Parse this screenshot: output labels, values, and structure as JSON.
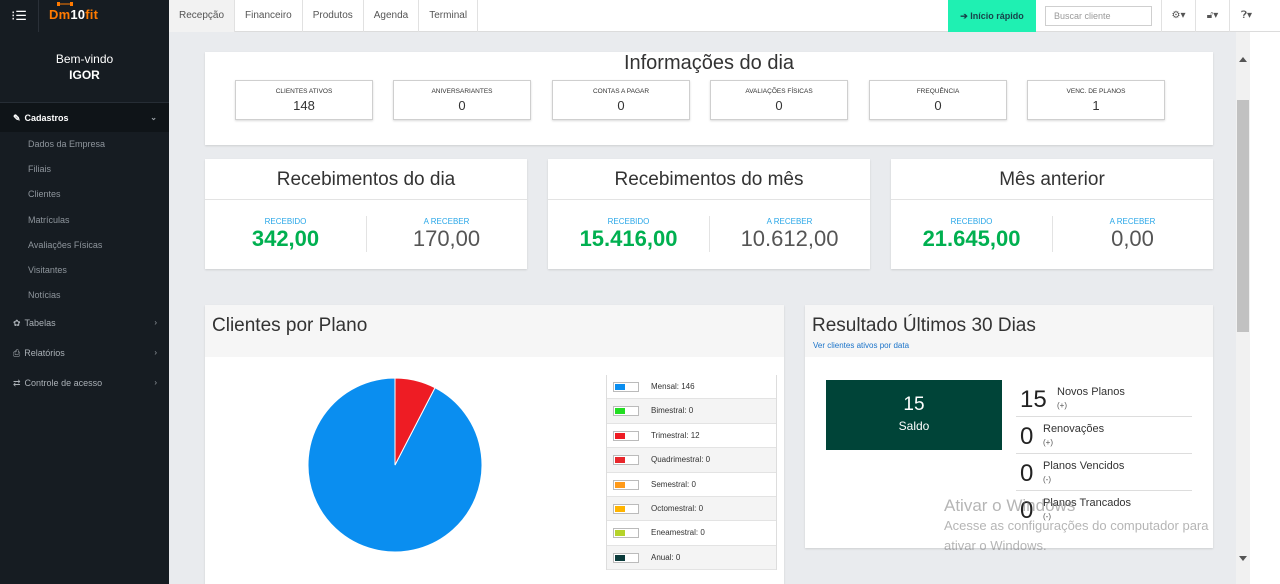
{
  "topbar": {
    "logo": {
      "prefix": "Dm",
      "mid": "10",
      "suffix": "fit"
    },
    "tabs": [
      "Recepção",
      "Financeiro",
      "Produtos",
      "Agenda",
      "Terminal"
    ],
    "quick_start": "Início rápido",
    "search_placeholder": "Buscar cliente"
  },
  "sidebar": {
    "welcome": "Bem-vindo",
    "user": "IGOR",
    "section": "Cadastros",
    "subitems": [
      "Dados da Empresa",
      "Filiais",
      "Clientes",
      "Matrículas",
      "Avaliações Físicas",
      "Visitantes",
      "Notícias"
    ],
    "menus": [
      "Tabelas",
      "Relatórios",
      "Controle de acesso"
    ]
  },
  "info_dia": {
    "title": "Informações do dia",
    "stats": [
      {
        "label": "CLIENTES ATIVOS",
        "value": "148"
      },
      {
        "label": "ANIVERSARIANTES",
        "value": "0"
      },
      {
        "label": "CONTAS A PAGAR",
        "value": "0"
      },
      {
        "label": "AVALIAÇÕES FÍSICAS",
        "value": "0"
      },
      {
        "label": "FREQUÊNCIA",
        "value": "0"
      },
      {
        "label": "VENC. DE PLANOS",
        "value": "1"
      }
    ]
  },
  "recebimentos": [
    {
      "title": "Recebimentos do dia",
      "recebido_label": "RECEBIDO",
      "recebido": "342,00",
      "areceber_label": "A RECEBER",
      "areceber": "170,00"
    },
    {
      "title": "Recebimentos do mês",
      "recebido_label": "RECEBIDO",
      "recebido": "15.416,00",
      "areceber_label": "A RECEBER",
      "areceber": "10.612,00"
    },
    {
      "title": "Mês anterior",
      "recebido_label": "RECEBIDO",
      "recebido": "21.645,00",
      "areceber_label": "A RECEBER",
      "areceber": "0,00"
    }
  ],
  "clientes_plano": {
    "title": "Clientes por Plano",
    "legend": [
      {
        "label": "Mensal: 146",
        "color": "#0a8ef0"
      },
      {
        "label": "Bimestral: 0",
        "color": "#22dd22"
      },
      {
        "label": "Trimestral: 12",
        "color": "#ee1c24"
      },
      {
        "label": "Quadrimestral: 0",
        "color": "#e8262b"
      },
      {
        "label": "Semestral: 0",
        "color": "#ff9a1a"
      },
      {
        "label": "Octomestral: 0",
        "color": "#ffb400"
      },
      {
        "label": "Eneamestral: 0",
        "color": "#b5d32a"
      },
      {
        "label": "Anual: 0",
        "color": "#0b3b3b"
      }
    ]
  },
  "chart_data": {
    "type": "pie",
    "categories": [
      "Mensal",
      "Bimestral",
      "Trimestral",
      "Quadrimestral",
      "Semestral",
      "Octomestral",
      "Eneamestral",
      "Anual"
    ],
    "values": [
      146,
      0,
      12,
      0,
      0,
      0,
      0,
      0
    ],
    "colors": [
      "#0a8ef0",
      "#22dd22",
      "#ee1c24",
      "#e8262b",
      "#ff9a1a",
      "#ffb400",
      "#b5d32a",
      "#0b3b3b"
    ],
    "title": "Clientes por Plano",
    "legend": "right"
  },
  "resultado": {
    "title": "Resultado Últimos 30 Dias",
    "link": "Ver clientes ativos por data",
    "saldo_value": "15",
    "saldo_label": "Saldo",
    "rows": [
      {
        "value": "15",
        "name": "Novos Planos",
        "sign": "(+)"
      },
      {
        "value": "0",
        "name": "Renovações",
        "sign": "(+)"
      },
      {
        "value": "0",
        "name": "Planos Vencidos",
        "sign": "(-)"
      },
      {
        "value": "0",
        "name": "Planos Trancados",
        "sign": "(-)"
      }
    ]
  },
  "watermark": {
    "line1": "Ativar o Windows",
    "line2": "Acesse as configurações do computador para",
    "line3": "ativar o Windows."
  }
}
